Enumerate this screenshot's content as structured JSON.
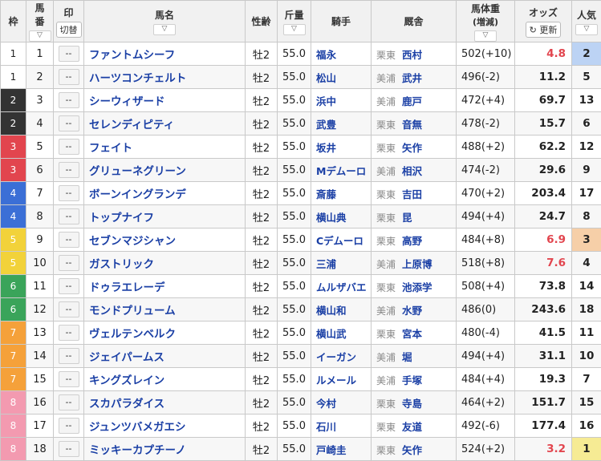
{
  "header": {
    "waku": "枠",
    "umaban_line1": "馬",
    "umaban_line2": "番",
    "mark": "印",
    "mark_toggle": "切替",
    "horse_name": "馬名",
    "sex_age": "性齢",
    "kinryo": "斤量",
    "jockey": "騎手",
    "trainer": "厩舎",
    "weight": "馬体重",
    "weight_sub": "(増減)",
    "odds": "オッズ",
    "refresh": "更新",
    "popularity": "人気",
    "sort_glyph": "▽",
    "refresh_icon": "↻"
  },
  "colors": {
    "waku": {
      "1": "#ffffff",
      "2": "#333333",
      "3": "#e2454e",
      "4": "#3b6fd6",
      "5": "#f2d23a",
      "6": "#3aa45a",
      "7": "#f5a13a",
      "8": "#f39ab0"
    },
    "waku_text": {
      "1": "#222222",
      "2": "#ffffff",
      "3": "#ffffff",
      "4": "#ffffff",
      "5": "#ffffff",
      "6": "#ffffff",
      "7": "#ffffff",
      "8": "#ffffff"
    },
    "pop1_bg": "#f6eb94",
    "pop2_bg": "#bcd3f4",
    "pop3_bg": "#f6cfa8",
    "hot_odds": "#e2454e"
  },
  "rows": [
    {
      "waku": "1",
      "num": "1",
      "mark": "--",
      "name": "ファントムシーフ",
      "sex": "牡2",
      "kinryo": "55.0",
      "jockey": "福永",
      "region": "栗東",
      "trainer": "西村",
      "weight": "502(+10)",
      "odds": "4.8",
      "pop": "2",
      "hot": true
    },
    {
      "waku": "1",
      "num": "2",
      "mark": "--",
      "name": "ハーツコンチェルト",
      "sex": "牡2",
      "kinryo": "55.0",
      "jockey": "松山",
      "region": "美浦",
      "trainer": "武井",
      "weight": "496(-2)",
      "odds": "11.2",
      "pop": "5",
      "hot": false
    },
    {
      "waku": "2",
      "num": "3",
      "mark": "--",
      "name": "シーウィザード",
      "sex": "牡2",
      "kinryo": "55.0",
      "jockey": "浜中",
      "region": "美浦",
      "trainer": "鹿戸",
      "weight": "472(+4)",
      "odds": "69.7",
      "pop": "13",
      "hot": false
    },
    {
      "waku": "2",
      "num": "4",
      "mark": "--",
      "name": "セレンディピティ",
      "sex": "牡2",
      "kinryo": "55.0",
      "jockey": "武豊",
      "region": "栗東",
      "trainer": "音無",
      "weight": "478(-2)",
      "odds": "15.7",
      "pop": "6",
      "hot": false
    },
    {
      "waku": "3",
      "num": "5",
      "mark": "--",
      "name": "フェイト",
      "sex": "牡2",
      "kinryo": "55.0",
      "jockey": "坂井",
      "region": "栗東",
      "trainer": "矢作",
      "weight": "488(+2)",
      "odds": "62.2",
      "pop": "12",
      "hot": false
    },
    {
      "waku": "3",
      "num": "6",
      "mark": "--",
      "name": "グリューネグリーン",
      "sex": "牡2",
      "kinryo": "55.0",
      "jockey": "Mデムーロ",
      "region": "美浦",
      "trainer": "相沢",
      "weight": "474(-2)",
      "odds": "29.6",
      "pop": "9",
      "hot": false
    },
    {
      "waku": "4",
      "num": "7",
      "mark": "--",
      "name": "ボーンイングランデ",
      "sex": "牡2",
      "kinryo": "55.0",
      "jockey": "斎藤",
      "region": "栗東",
      "trainer": "吉田",
      "weight": "470(+2)",
      "odds": "203.4",
      "pop": "17",
      "hot": false
    },
    {
      "waku": "4",
      "num": "8",
      "mark": "--",
      "name": "トップナイフ",
      "sex": "牡2",
      "kinryo": "55.0",
      "jockey": "横山典",
      "region": "栗東",
      "trainer": "昆",
      "weight": "494(+4)",
      "odds": "24.7",
      "pop": "8",
      "hot": false
    },
    {
      "waku": "5",
      "num": "9",
      "mark": "--",
      "name": "セブンマジシャン",
      "sex": "牡2",
      "kinryo": "55.0",
      "jockey": "Cデムーロ",
      "region": "栗東",
      "trainer": "高野",
      "weight": "484(+8)",
      "odds": "6.9",
      "pop": "3",
      "hot": true
    },
    {
      "waku": "5",
      "num": "10",
      "mark": "--",
      "name": "ガストリック",
      "sex": "牡2",
      "kinryo": "55.0",
      "jockey": "三浦",
      "region": "美浦",
      "trainer": "上原博",
      "weight": "518(+8)",
      "odds": "7.6",
      "pop": "4",
      "hot": true
    },
    {
      "waku": "6",
      "num": "11",
      "mark": "--",
      "name": "ドゥラエレーデ",
      "sex": "牡2",
      "kinryo": "55.0",
      "jockey": "ムルザバエ",
      "region": "栗東",
      "trainer": "池添学",
      "weight": "508(+4)",
      "odds": "73.8",
      "pop": "14",
      "hot": false
    },
    {
      "waku": "6",
      "num": "12",
      "mark": "--",
      "name": "モンドプリューム",
      "sex": "牡2",
      "kinryo": "55.0",
      "jockey": "横山和",
      "region": "美浦",
      "trainer": "水野",
      "weight": "486(0)",
      "odds": "243.6",
      "pop": "18",
      "hot": false
    },
    {
      "waku": "7",
      "num": "13",
      "mark": "--",
      "name": "ヴェルテンベルク",
      "sex": "牡2",
      "kinryo": "55.0",
      "jockey": "横山武",
      "region": "栗東",
      "trainer": "宮本",
      "weight": "480(-4)",
      "odds": "41.5",
      "pop": "11",
      "hot": false
    },
    {
      "waku": "7",
      "num": "14",
      "mark": "--",
      "name": "ジェイパームス",
      "sex": "牡2",
      "kinryo": "55.0",
      "jockey": "イーガン",
      "region": "美浦",
      "trainer": "堀",
      "weight": "494(+4)",
      "odds": "31.1",
      "pop": "10",
      "hot": false
    },
    {
      "waku": "7",
      "num": "15",
      "mark": "--",
      "name": "キングズレイン",
      "sex": "牡2",
      "kinryo": "55.0",
      "jockey": "ルメール",
      "region": "美浦",
      "trainer": "手塚",
      "weight": "484(+4)",
      "odds": "19.3",
      "pop": "7",
      "hot": false
    },
    {
      "waku": "8",
      "num": "16",
      "mark": "--",
      "name": "スカパラダイス",
      "sex": "牡2",
      "kinryo": "55.0",
      "jockey": "今村",
      "region": "栗東",
      "trainer": "寺島",
      "weight": "464(+2)",
      "odds": "151.7",
      "pop": "15",
      "hot": false
    },
    {
      "waku": "8",
      "num": "17",
      "mark": "--",
      "name": "ジュンツバメガエシ",
      "sex": "牡2",
      "kinryo": "55.0",
      "jockey": "石川",
      "region": "栗東",
      "trainer": "友道",
      "weight": "492(-6)",
      "odds": "177.4",
      "pop": "16",
      "hot": false
    },
    {
      "waku": "8",
      "num": "18",
      "mark": "--",
      "name": "ミッキーカプチーノ",
      "sex": "牡2",
      "kinryo": "55.0",
      "jockey": "戸崎圭",
      "region": "栗東",
      "trainer": "矢作",
      "weight": "524(+2)",
      "odds": "3.2",
      "pop": "1",
      "hot": true
    }
  ]
}
